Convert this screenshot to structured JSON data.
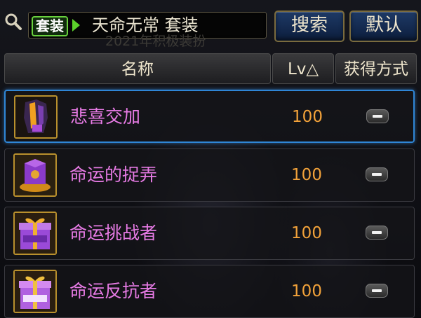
{
  "search": {
    "tag_label": "套装",
    "query": "天命无常  套装"
  },
  "buttons": {
    "search_label": "搜索",
    "default_label": "默认"
  },
  "background_text": "2021年积极装扮",
  "table": {
    "columns": [
      "名称",
      "Lv△",
      "获得方式"
    ],
    "rows": [
      {
        "name": "悲喜交加",
        "level": "100",
        "icon": "armor-icon",
        "selected": true
      },
      {
        "name": "命运的捉弄",
        "level": "100",
        "icon": "purple-box-icon",
        "selected": false
      },
      {
        "name": "命运挑战者",
        "level": "100",
        "icon": "gift-box-icon",
        "selected": false
      },
      {
        "name": "命运反抗者",
        "level": "100",
        "icon": "gift-box-icon",
        "selected": false
      }
    ]
  },
  "colors": {
    "item_name": "#e77be5",
    "level": "#f2a23a",
    "selection_border": "#2f86d6",
    "tag_border": "#69d13e"
  }
}
